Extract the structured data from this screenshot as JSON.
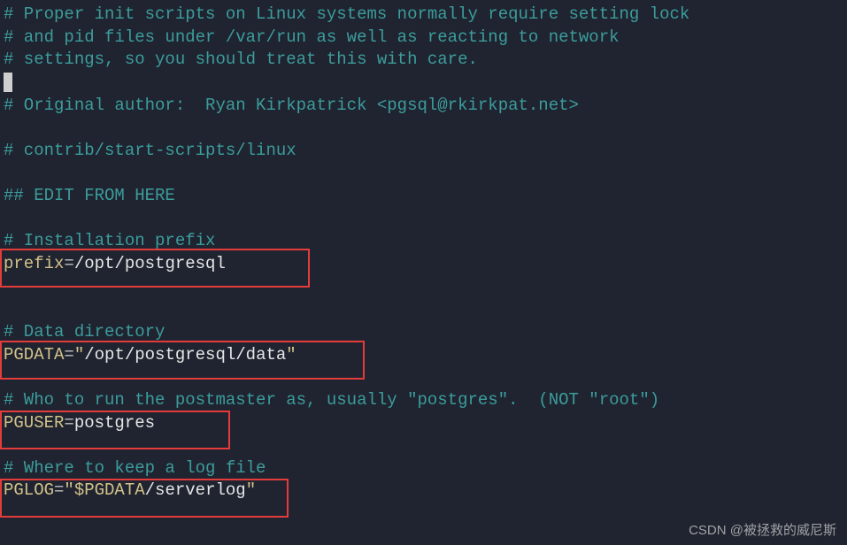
{
  "lines": {
    "c1": "# Proper init scripts on Linux systems normally require setting lock",
    "c2": "# and pid files under /var/run as well as reacting to network",
    "c3": "# settings, so you should treat this with care.",
    "c4": "# Original author:  Ryan Kirkpatrick <pgsql@rkirkpat.net>",
    "c5": "# contrib/start-scripts/linux",
    "c6": "## EDIT FROM HERE",
    "c7": "# Installation prefix",
    "c8": "# Data directory",
    "c9": "# Who to run the postmaster as, usually \"postgres\".  (NOT \"root\")",
    "c10": "# Where to keep a log file"
  },
  "assignments": {
    "prefix": {
      "name": "prefix",
      "eq": "=",
      "value": "/opt/postgresql"
    },
    "pgdata": {
      "name": "PGDATA",
      "eq": "=",
      "q": "\"",
      "value": "/opt/postgresql/data"
    },
    "pguser": {
      "name": "PGUSER",
      "eq": "=",
      "value": "postgres"
    },
    "pglog": {
      "name": "PGLOG",
      "eq": "=",
      "q": "\"",
      "var": "$PGDATA",
      "tail": "/serverlog"
    }
  },
  "watermark": "CSDN @被拯救的威尼斯"
}
